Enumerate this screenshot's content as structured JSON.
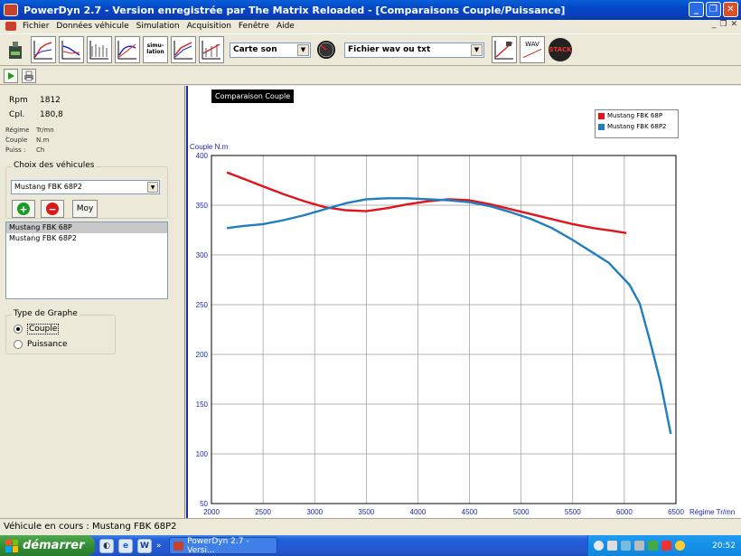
{
  "window": {
    "title": "PowerDyn 2.7 - Version enregistrée par The Matrix Reloaded - [Comparaisons Couple/Puissance]",
    "minimize": "_",
    "maximize": "❐",
    "close": "✕"
  },
  "menu": {
    "items": [
      "Fichier",
      "Données véhicule",
      "Simulation",
      "Acquisition",
      "Fenêtre",
      "Aide"
    ],
    "mdi_minimize": "_",
    "mdi_restore": "❐",
    "mdi_close": "✕"
  },
  "toolbar": {
    "sound_source": "Carte son",
    "file_type": "Fichier wav ou txt",
    "simulation_tool_label": "simu-lation",
    "wav_tool_label": "WAV",
    "stack_tool_label": "STACK"
  },
  "readout": {
    "rpm_label": "Rpm",
    "rpm_value": "1812",
    "cpl_label": "Cpl.",
    "cpl_value": "180,8",
    "regime_label": "Régime :",
    "regime_unit": "Tr/mn",
    "couple_label": "Couple :",
    "couple_unit": "N.m",
    "puiss_label": "Puiss :",
    "puiss_unit": "Ch"
  },
  "vehicles": {
    "group_title": "Choix des véhicules",
    "selected": "Mustang FBK 68P2",
    "add_icon": "plus-icon",
    "remove_icon": "minus-icon",
    "average_label": "Moy",
    "list": [
      {
        "label": "Mustang FBK 68P",
        "selected": true
      },
      {
        "label": "Mustang FBK 68P2",
        "selected": false
      }
    ]
  },
  "graph_type": {
    "group_title": "Type de Graphe",
    "options": [
      {
        "label": "Couple",
        "checked": true
      },
      {
        "label": "Puissance",
        "checked": false
      }
    ]
  },
  "chart_data": {
    "type": "line",
    "title": "Comparaison Couple",
    "ylabel": "Couple N.m",
    "xlabel": "Régime Tr/mn",
    "xlim": [
      2000,
      6500
    ],
    "ylim": [
      50,
      400
    ],
    "xticks": [
      2000,
      2500,
      3000,
      3500,
      4000,
      4500,
      5000,
      5500,
      6000,
      6500
    ],
    "yticks": [
      50,
      100,
      150,
      200,
      250,
      300,
      350,
      400
    ],
    "grid": true,
    "legend_position": "top-right",
    "series": [
      {
        "name": "Mustang FBK 68P",
        "color": "#e0141a",
        "x": [
          2150,
          2300,
          2500,
          2700,
          2900,
          3100,
          3300,
          3500,
          3700,
          3900,
          4100,
          4300,
          4500,
          4700,
          4900,
          5100,
          5300,
          5500,
          5700,
          5900,
          6020
        ],
        "y": [
          383,
          377,
          369,
          361,
          354,
          348,
          345,
          344,
          347,
          351,
          354,
          356,
          355,
          351,
          346,
          341,
          336,
          331,
          327,
          324,
          322
        ]
      },
      {
        "name": "Mustang FBK 68P2",
        "color": "#1f7ec0",
        "x": [
          2150,
          2300,
          2500,
          2700,
          2900,
          3100,
          3300,
          3500,
          3700,
          3900,
          4100,
          4300,
          4500,
          4700,
          4900,
          5100,
          5300,
          5500,
          5700,
          5850,
          5950,
          6050,
          6150,
          6250,
          6350,
          6450
        ],
        "y": [
          327,
          329,
          331,
          335,
          340,
          346,
          352,
          356,
          357,
          357,
          356,
          355,
          353,
          349,
          343,
          336,
          327,
          315,
          302,
          292,
          281,
          270,
          251,
          213,
          172,
          120
        ]
      }
    ]
  },
  "status": {
    "current_vehicle": "Véhicule en cours : Mustang FBK 68P2"
  },
  "taskbar": {
    "start_label": "démarrer",
    "task_label": "PowerDyn 2.7 - Versi...",
    "quick_more": "»",
    "clock": "20:52"
  }
}
